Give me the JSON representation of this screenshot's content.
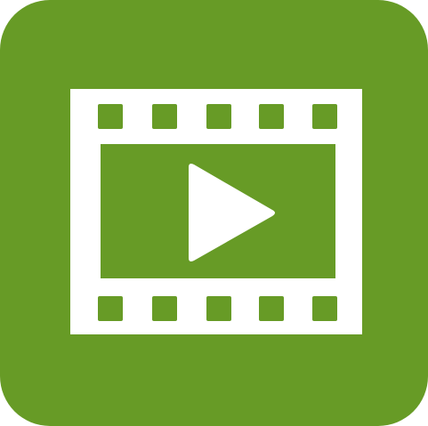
{
  "icon": {
    "name": "video-player-app-icon",
    "glyph": "film-strip-with-play-icon"
  },
  "colors": {
    "brand_green": "#679b26",
    "foreground": "#ffffff"
  }
}
